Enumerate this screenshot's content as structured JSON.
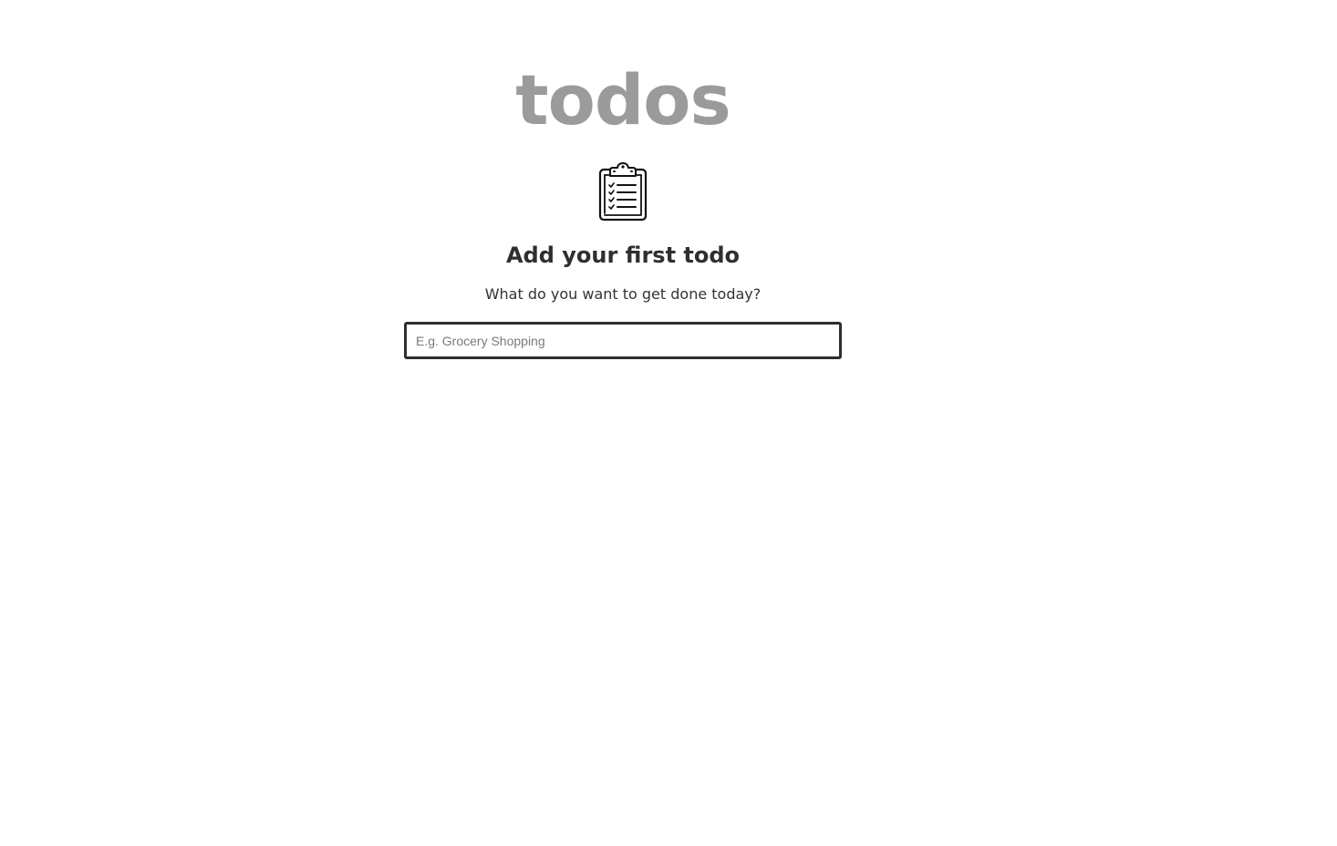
{
  "app": {
    "title": "todos"
  },
  "empty_state": {
    "icon": "clipboard-checklist-icon",
    "heading": "Add your first todo",
    "subtitle": "What do you want to get done today?"
  },
  "new_todo": {
    "value": "",
    "placeholder": "E.g. Grocery Shopping"
  },
  "colors": {
    "title": "#9b9b9b",
    "heading": "#2f2f2f",
    "input_border": "#2e2e2e"
  }
}
